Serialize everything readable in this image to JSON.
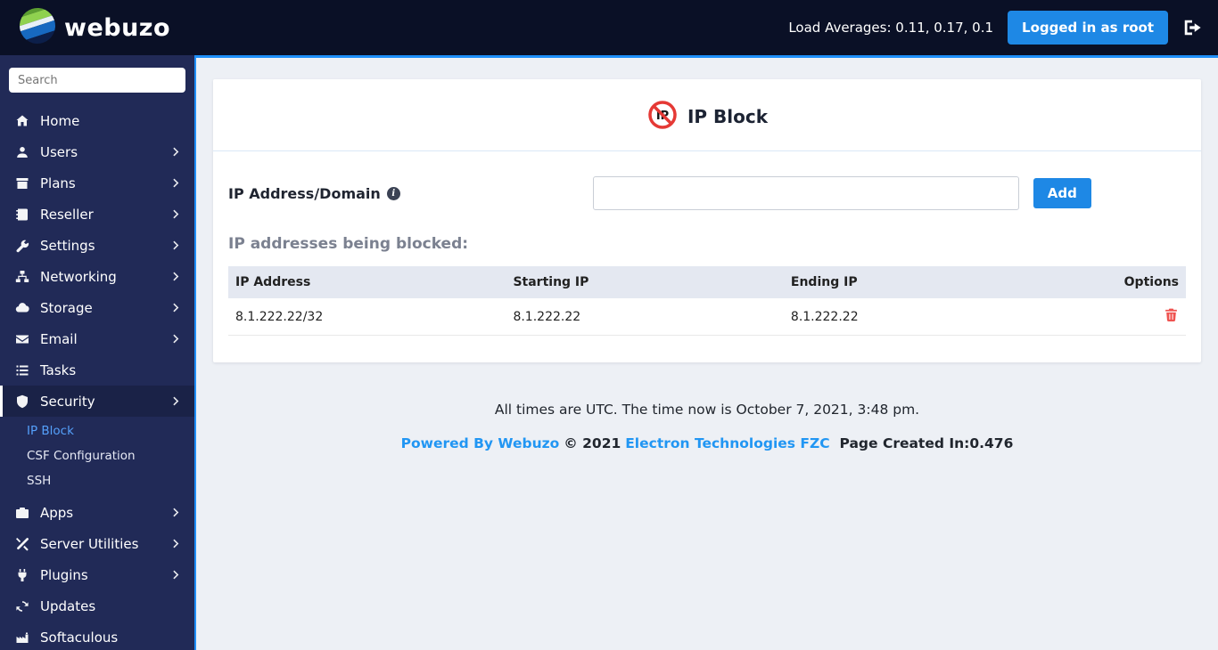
{
  "topbar": {
    "brand": "webuzo",
    "load_averages": "Load Averages: 0.11, 0.17, 0.1",
    "logged_in_button": "Logged in as root"
  },
  "sidebar": {
    "search_placeholder": "Search",
    "items": [
      {
        "label": "Home"
      },
      {
        "label": "Users"
      },
      {
        "label": "Plans"
      },
      {
        "label": "Reseller"
      },
      {
        "label": "Settings"
      },
      {
        "label": "Networking"
      },
      {
        "label": "Storage"
      },
      {
        "label": "Email"
      },
      {
        "label": "Tasks"
      },
      {
        "label": "Security"
      },
      {
        "label": "Apps"
      },
      {
        "label": "Server Utilities"
      },
      {
        "label": "Plugins"
      },
      {
        "label": "Updates"
      },
      {
        "label": "Softaculous"
      }
    ],
    "security_submenu": [
      {
        "label": "IP Block"
      },
      {
        "label": "CSF Configuration"
      },
      {
        "label": "SSH"
      }
    ]
  },
  "main": {
    "title": "IP Block",
    "ip_label": "IP Address/Domain",
    "ip_input_value": "",
    "add_button": "Add",
    "blocked_heading": "IP addresses being blocked:",
    "table": {
      "headers": [
        "IP Address",
        "Starting IP",
        "Ending IP",
        "Options"
      ],
      "rows": [
        {
          "ip_address": "8.1.222.22/32",
          "starting_ip": "8.1.222.22",
          "ending_ip": "8.1.222.22"
        }
      ]
    }
  },
  "footer": {
    "time_note": "All times are UTC. The time now is October 7, 2021, 3:48 pm.",
    "powered_by": "Powered By Webuzo",
    "copyright": "© 2021",
    "company": "Electron Technologies FZC",
    "page_created": "Page Created In:0.476"
  },
  "colors": {
    "accent": "#1e88e5",
    "link": "#2196f3",
    "danger": "#ef5350",
    "topbar_bg": "#0a1026",
    "sidebar_bg": "#212a57"
  }
}
